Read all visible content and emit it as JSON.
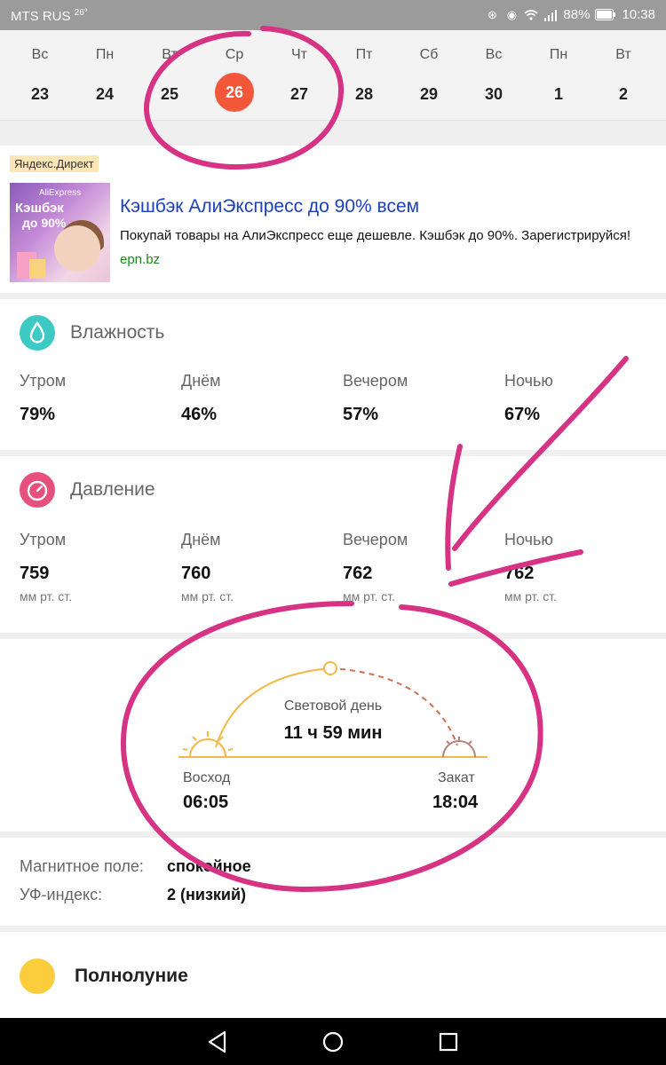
{
  "status_bar": {
    "carrier": "MTS RUS",
    "temperature": "26°",
    "battery": "88%",
    "time": "10:38"
  },
  "dates": [
    {
      "dow": "Вс",
      "day": "23"
    },
    {
      "dow": "Пн",
      "day": "24"
    },
    {
      "dow": "Вт",
      "day": "25"
    },
    {
      "dow": "Ср",
      "day": "26",
      "selected": true
    },
    {
      "dow": "Чт",
      "day": "27"
    },
    {
      "dow": "Пт",
      "day": "28"
    },
    {
      "dow": "Сб",
      "day": "29"
    },
    {
      "dow": "Вс",
      "day": "30"
    },
    {
      "dow": "Пн",
      "day": "1"
    },
    {
      "dow": "Вт",
      "day": "2"
    }
  ],
  "ad": {
    "label": "Яндекс.Директ",
    "image_brand": "AliExpress",
    "image_line1": "Кэшбэк",
    "image_line2": "до 90%",
    "title": "Кэшбэк АлиЭкспресс до 90% всем",
    "text": "Покупай товары на АлиЭкспресс еще дешевле. Кэшбэк до 90%. Зарегистрируйся!",
    "link": "epn.bz"
  },
  "humidity": {
    "title": "Влажность",
    "icon": "droplet-icon",
    "color": "#3dc9c4",
    "periods": [
      {
        "label": "Утром",
        "value": "79%"
      },
      {
        "label": "Днём",
        "value": "46%"
      },
      {
        "label": "Вечером",
        "value": "57%"
      },
      {
        "label": "Ночью",
        "value": "67%"
      }
    ]
  },
  "pressure": {
    "title": "Давление",
    "icon": "gauge-icon",
    "color": "#e5507c",
    "unit": "мм рт. ст.",
    "periods": [
      {
        "label": "Утром",
        "value": "759"
      },
      {
        "label": "Днём",
        "value": "760"
      },
      {
        "label": "Вечером",
        "value": "762"
      },
      {
        "label": "Ночью",
        "value": "762"
      }
    ]
  },
  "daylight": {
    "title": "Световой день",
    "duration": "11 ч 59 мин",
    "sunrise_label": "Восход",
    "sunrise_time": "06:05",
    "sunset_label": "Закат",
    "sunset_time": "18:04",
    "arc_color": "#f5b845",
    "sunset_color": "#d1704f"
  },
  "extra": {
    "magnetic_label": "Магнитное поле:",
    "magnetic_value": "спокойное",
    "uv_label": "УФ-индекс:",
    "uv_value": "2 (низкий)"
  },
  "moon": {
    "phase": "Полнолуние",
    "color": "#fbcc3c"
  },
  "annotation_color": "#d63384"
}
